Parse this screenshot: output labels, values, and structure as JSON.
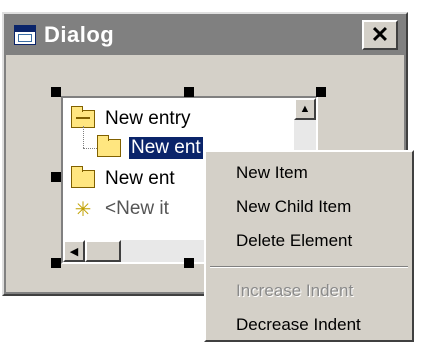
{
  "window": {
    "title": "Dialog",
    "close_label": "✕"
  },
  "tree": {
    "nodes": [
      {
        "label": "New entry"
      },
      {
        "label": "New ent"
      },
      {
        "label": "New ent"
      },
      {
        "label": "<New it"
      }
    ]
  },
  "scrollbar": {
    "up_arrow": "▲",
    "left_arrow": "◀"
  },
  "context_menu": {
    "items": [
      {
        "label": "New Item",
        "enabled": true
      },
      {
        "label": "New Child Item",
        "enabled": true
      },
      {
        "label": "Delete Element",
        "enabled": true
      },
      {
        "label": "Increase Indent",
        "enabled": false
      },
      {
        "label": "Decrease Indent",
        "enabled": true
      }
    ]
  }
}
